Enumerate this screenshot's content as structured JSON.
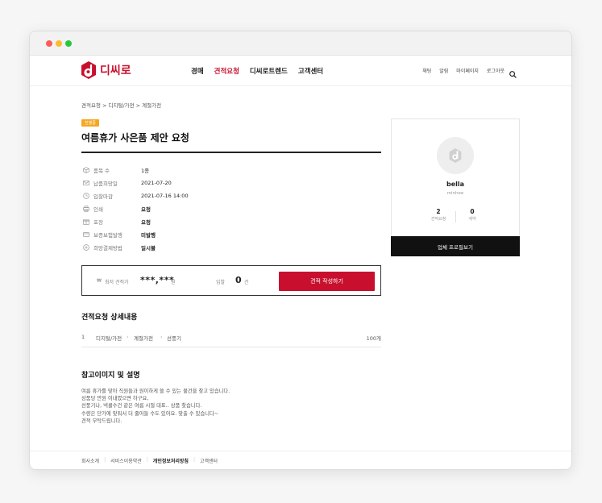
{
  "brand": {
    "name": "디씨로",
    "accent": "#c8102e",
    "logo_icon": "d-logo-icon"
  },
  "nav": {
    "items": [
      "경매",
      "견적요청",
      "디씨로트렌드",
      "고객센터"
    ],
    "active_index": 1
  },
  "utility": {
    "items": [
      "채팅",
      "알림",
      "마이페이지",
      "로그아웃"
    ],
    "search_icon": "search-icon"
  },
  "breadcrumb": "견적요청 > 디지털/가전 > 계절가전",
  "status_badge": "진행중",
  "request_title": "여름휴가 사은품 제안 요청",
  "info": [
    {
      "icon": "cube-icon",
      "label": "품목 수",
      "value": "1종"
    },
    {
      "icon": "envelope-icon",
      "label": "납품희망일",
      "value": "2021-07-20"
    },
    {
      "icon": "clock-icon",
      "label": "입찰마감",
      "value": "2021-07-16 14:00"
    },
    {
      "icon": "print-icon",
      "label": "인쇄",
      "value": "요청"
    },
    {
      "icon": "gift-icon",
      "label": "포장",
      "value": "요청"
    },
    {
      "icon": "shield-icon",
      "label": "보증보험발행",
      "value": "미발행"
    },
    {
      "icon": "payment-icon",
      "label": "희망결제방법",
      "value": "일시불"
    }
  ],
  "quote_box": {
    "won_symbol": "₩",
    "lowest_label": "최저 견적가",
    "lowest_price": "***,***",
    "price_unit": "원",
    "bid_label": "입찰",
    "bid_count": "0",
    "bid_unit": "건",
    "button_label": "견적 작성하기"
  },
  "detail_section": {
    "title": "견적요청 상세내용",
    "row": {
      "no": "1",
      "category_path": [
        "디지털/가전",
        "계절가전",
        "선풍기"
      ],
      "quantity": "100개"
    }
  },
  "reference_section": {
    "title": "참고이미지 및 설명",
    "lines": [
      "여름 휴가를 맞아 직원들과 원이하게 쓸 수 있는 물건을 찾고 있습니다.",
      "상품당 만원 이내였으면 하구요,",
      "선풍기나, 넥쿨수건 같은 여름 시절 대표.. 상품 찾습니다.",
      "수량은 단가에 맞춰서 더 줄어들 수도 있어요. 맞출 수 있습니다~",
      "견적 부탁드립니다."
    ]
  },
  "profile": {
    "name": "bella",
    "id": "minhee",
    "stats": [
      {
        "num": "2",
        "label": "견적요청"
      },
      {
        "num": "0",
        "label": "계약"
      }
    ],
    "button_label": "업체 프로필보기"
  },
  "footer": {
    "links": [
      "회사소개",
      "서비스이용약관",
      "개인정보처리방침",
      "고객센터"
    ],
    "bold_index": 2
  }
}
